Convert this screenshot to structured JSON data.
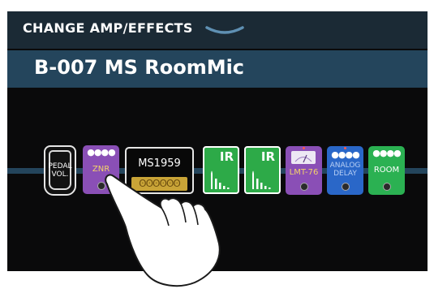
{
  "header": {
    "title": "CHANGE AMP/EFFECTS"
  },
  "preset": {
    "name": "B-007 MS RoomMic"
  },
  "chain": {
    "pedal": {
      "label_line1": "PEDAL",
      "label_line2": "VOL."
    },
    "zno": {
      "knobs": "●●●●",
      "label": "ZNR"
    },
    "amp": {
      "label": "MS1959",
      "controls": "ʘʘʘʘʘʘ"
    },
    "ir1": {
      "label": "IR"
    },
    "ir2": {
      "label": "IR"
    },
    "lmt": {
      "label": "LMT-76"
    },
    "delay": {
      "knobs": "●●●●",
      "label_line1": "ANALOG",
      "label_line2": "DELAY"
    },
    "room": {
      "knobs": "●●●●",
      "label": "ROOM"
    }
  },
  "colors": {
    "header_bg": "#1b2a35",
    "preset_bar": "#24455c",
    "purple_effect": "#8a4fb6",
    "green_effect": "#2daa48",
    "blue_effect": "#2a67c8"
  },
  "icons": {
    "header_chevron": "chevron-down-icon",
    "gesture": "tapping-hand-icon"
  }
}
